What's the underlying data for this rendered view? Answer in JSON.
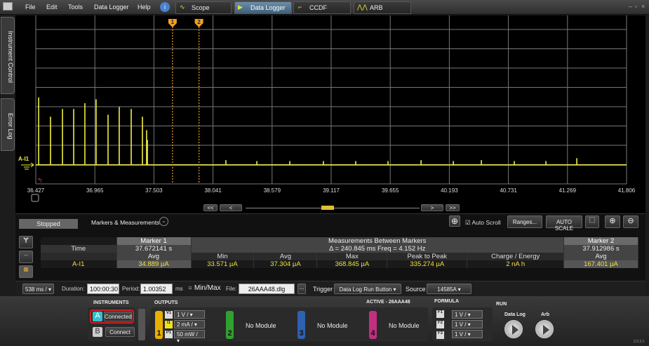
{
  "menu": {
    "items": [
      "File",
      "Edit",
      "Tools",
      "Data Logger",
      "Help"
    ]
  },
  "tabs": [
    {
      "label": "Scope"
    },
    {
      "label": "Data Logger",
      "active": true
    },
    {
      "label": "CCDF"
    },
    {
      "label": "ARB"
    }
  ],
  "window_controls": [
    "minimize",
    "restore",
    "close"
  ],
  "side_tabs": [
    "Instrument Control",
    "Error Log"
  ],
  "chart_data": {
    "type": "line",
    "xlabel": "",
    "ylabel": "",
    "xlim": [
      36.427,
      41.806
    ],
    "x_ticks": [
      "36.427",
      "36.965",
      "37.503",
      "38.041",
      "38.579",
      "39.117",
      "39.655",
      "40.193",
      "40.731",
      "41.269",
      "41.806"
    ],
    "grid": true,
    "trace_label": "A-I1",
    "trace_color": "#f0f040",
    "y_units": "divisions above baseline",
    "spikes": [
      {
        "t": 36.453,
        "amp": 3.5
      },
      {
        "t": 36.561,
        "amp": 2.5
      },
      {
        "t": 36.67,
        "amp": 2.9
      },
      {
        "t": 36.772,
        "amp": 2.9
      },
      {
        "t": 36.874,
        "amp": 3.2
      },
      {
        "t": 36.976,
        "amp": 3.4
      },
      {
        "t": 37.085,
        "amp": 2.6
      },
      {
        "t": 37.187,
        "amp": 3.0
      },
      {
        "t": 37.296,
        "amp": 2.9
      },
      {
        "t": 37.398,
        "amp": 2.5
      },
      {
        "t": 37.436,
        "amp": 1.8
      },
      {
        "t": 37.443,
        "amp": 1.3
      },
      {
        "t": 38.158,
        "amp": 0.25
      },
      {
        "t": 38.44,
        "amp": 0.2
      },
      {
        "t": 38.74,
        "amp": 0.2
      },
      {
        "t": 39.046,
        "amp": 0.2
      },
      {
        "t": 39.34,
        "amp": 0.2
      },
      {
        "t": 39.634,
        "amp": 0.2
      },
      {
        "t": 39.935,
        "amp": 0.25
      },
      {
        "t": 40.229,
        "amp": 0.2
      },
      {
        "t": 40.484,
        "amp": 0.25
      },
      {
        "t": 40.784,
        "amp": 0.2
      },
      {
        "t": 41.072,
        "amp": 0.2
      },
      {
        "t": 41.353,
        "amp": 0.35
      }
    ],
    "markers": [
      {
        "label": "1",
        "t": 37.672141
      },
      {
        "label": "2",
        "t": 37.912986
      }
    ],
    "marker_color": "#f0a020"
  },
  "nav": {
    "first": "<<",
    "prev": "<",
    "next": ">",
    "last": ">>"
  },
  "panel": {
    "status": "Stopped",
    "markers_label": "Markers & Measurements",
    "auto_scroll": "Auto Scroll",
    "ranges": "Ranges...",
    "auto_scale": "AUTO SCALE",
    "table": {
      "marker1": "Marker 1",
      "between": "Measurements Between Markers",
      "marker2": "Marker 2",
      "time_label": "Time",
      "m1_time": "37.672141 s",
      "delta": "Δ = 240.845 ms   Freq = 4.152 Hz",
      "m2_time": "37.912986 s",
      "cols": [
        "Avg",
        "Min",
        "Avg",
        "Max",
        "Peak to Peak",
        "Charge / Energy",
        "Avg"
      ],
      "row_label": "A-I1",
      "values": [
        "34.889 µA",
        "33.571 µA",
        "37.304 µA",
        "368.845 µA",
        "335.274 µA",
        "2 nA h",
        "167.401 µA"
      ]
    }
  },
  "settings": {
    "timebase": "538 ms /",
    "duration_label": "Duration:",
    "duration": "100:00:30",
    "period_label": "Period:",
    "period": "1.00352",
    "period_unit": "ms",
    "minmax": "Min/Max",
    "file_label": "File:",
    "file": "26AAA48.dlg",
    "browse": "...",
    "trigger_label": "Trigger",
    "trigger": "Data Log Run Button",
    "source_label": "Source",
    "source": "14585A"
  },
  "bottom": {
    "instruments_label": "INSTRUMENTS",
    "inst_a": "A",
    "inst_a_status": "Connected",
    "inst_b": "B",
    "inst_b_status": "Connect",
    "outputs_label": "OUTPUTS",
    "active_label": "ACTIVE - 26AAA48",
    "ch1": {
      "num": "1",
      "v": "V1",
      "v_val": "1 V /",
      "i": "I1",
      "i_val": "2 mA /",
      "p": "P1",
      "p_val": "50 mW /"
    },
    "ch2": {
      "num": "2",
      "text": "No Module"
    },
    "ch3": {
      "num": "3",
      "text": "No Module"
    },
    "ch4": {
      "num": "4",
      "text": "No Module"
    },
    "formula_label": "FORMULA",
    "formulas": [
      {
        "n": "F1",
        "v": "1 V /"
      },
      {
        "n": "F2",
        "v": "1 V /"
      },
      {
        "n": "F3",
        "v": "1 V /"
      }
    ],
    "run_label": "RUN",
    "run_datalog": "Data Log",
    "run_arb": "Arb",
    "version": "2.0.2.1"
  },
  "colors": {
    "ch1": "#e8b000",
    "ch2": "#30a030",
    "ch3": "#3060b0",
    "ch4": "#c03080",
    "connected_outline": "#d02020",
    "inst_a": "#30c0d0"
  }
}
